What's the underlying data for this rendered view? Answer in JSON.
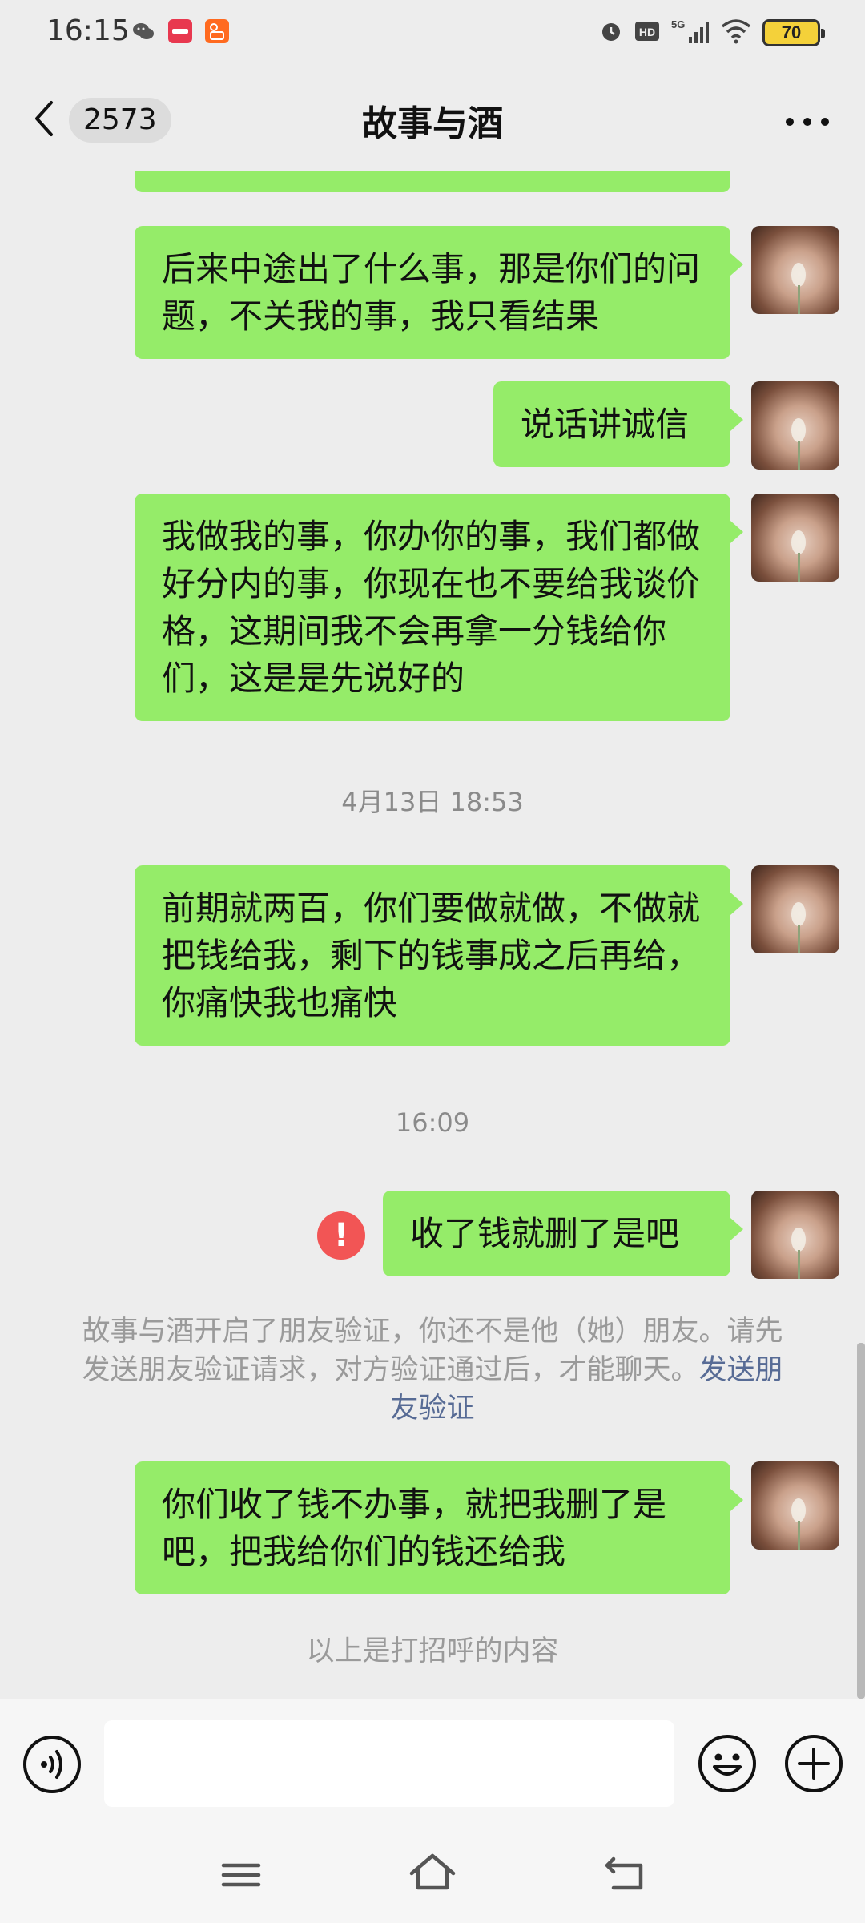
{
  "status_bar": {
    "time": "16:15",
    "app_icons": [
      "wechat-icon",
      "taobao-icon",
      "kuaishou-icon"
    ],
    "indicators": [
      "alarm-icon",
      "hd-icon",
      "5g-signal-icon",
      "wifi-icon"
    ],
    "battery": "70"
  },
  "header": {
    "unread_count": "2573",
    "title": "故事与酒"
  },
  "messages": [
    {
      "text": "后来中途出了什么事，那是你们的问题，不关我的事，我只看结果"
    },
    {
      "text": "说话讲诚信"
    },
    {
      "text": "我做我的事，你办你的事，我们都做好分内的事，你现在也不要给我谈价格，这期间我不会再拿一分钱给你们，这是是先说好的"
    },
    {
      "timestamp": "4月13日 18:53"
    },
    {
      "text": "前期就两百，你们要做就做，不做就把钱给我，剩下的钱事成之后再给，你痛快我也痛快"
    },
    {
      "timestamp": "16:09"
    },
    {
      "text": "收了钱就删了是吧",
      "failed": true
    },
    {
      "text": "你们收了钱不办事，就把我删了是吧，把我给你们的钱还给我"
    }
  ],
  "system_notice": {
    "text": "故事与酒开启了朋友验证，你还不是他（她）朋友。请先发送朋友验证请求，对方验证通过后，才能聊天。",
    "link": "发送朋友验证"
  },
  "footer_notice": "以上是打招呼的内容",
  "input_bar": {
    "value": "",
    "placeholder": ""
  },
  "colors": {
    "background": "#ededed",
    "bubble_self": "#95ec69",
    "link": "#576b95",
    "error": "#f25555"
  }
}
